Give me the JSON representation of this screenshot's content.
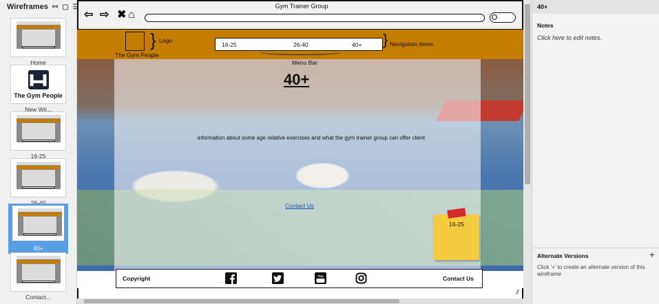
{
  "left_panel": {
    "title": "Wireframes",
    "wireframes": [
      {
        "label": "Home",
        "kind": "thumb"
      },
      {
        "label": "New Wir...",
        "kind": "logo",
        "logo_text": "The Gym People"
      },
      {
        "label": "16-25",
        "kind": "thumb"
      },
      {
        "label": "26-40",
        "kind": "thumb"
      },
      {
        "label": "40+",
        "kind": "thumb",
        "selected": true
      },
      {
        "label": "Contact...",
        "kind": "thumb"
      }
    ]
  },
  "canvas": {
    "browser_title": "Gym Trainer Group",
    "header": {
      "logo_label": "Logo",
      "brand_name": "The Gym People",
      "nav_items": [
        "16-25",
        "26-40",
        "40+"
      ],
      "nav_label": "Navigation items",
      "menu_bar_label": "Menu Bar"
    },
    "page_title": "40+",
    "info_text": "information about some age relative exercises and what the gym trainer group can offer client",
    "contact_link": "Contact Us",
    "sticky_note": "16-25",
    "footer": {
      "copyright": "Copyright",
      "contact": "Contact Us",
      "social_icons": [
        "facebook-icon",
        "twitter-icon",
        "youtube-icon",
        "instagram-icon"
      ]
    },
    "colors": {
      "header_bar": "#c47d00",
      "sticky": "#f5cb3f",
      "selected": "#5a9fe3"
    }
  },
  "right_panel": {
    "title": "40+",
    "notes_heading": "Notes",
    "notes_placeholder": "Click here to edit notes.",
    "alt_heading": "Alternate Versions",
    "alt_desc": "Click '+' to create an alternate version of this wireframe"
  }
}
